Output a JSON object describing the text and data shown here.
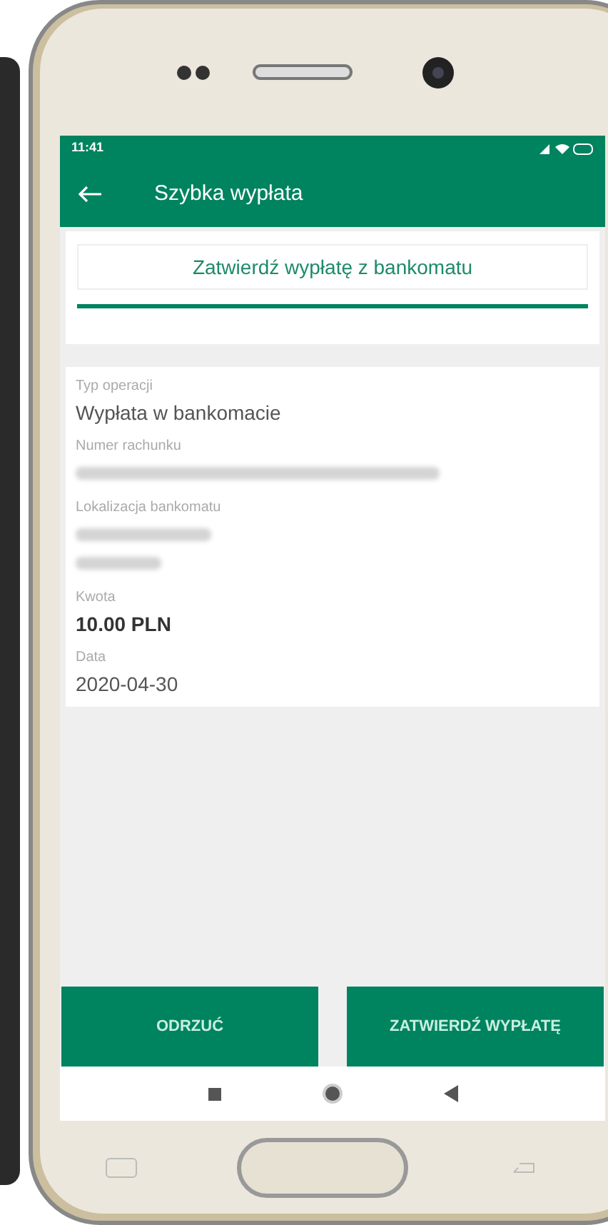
{
  "status_bar": {
    "time": "11:41"
  },
  "header": {
    "title": "Szybka wypłata"
  },
  "banner": {
    "title": "Zatwierdź wypłatę z bankomatu"
  },
  "details": [
    {
      "label": "Typ operacji",
      "kind": "text",
      "value": "Wypłata w bankomacie"
    },
    {
      "label": "Numer rachunku",
      "kind": "blurred"
    },
    {
      "label": "Lokalizacja bankomatu",
      "kind": "blurred-address"
    },
    {
      "label": "Kwota",
      "kind": "bold",
      "value": "10.00 PLN"
    },
    {
      "label": "Data",
      "kind": "text",
      "value": "2020-04-30"
    }
  ],
  "buttons": [
    "ODRZUĆ",
    "ZATWIERDŹ WYPŁATĘ"
  ]
}
